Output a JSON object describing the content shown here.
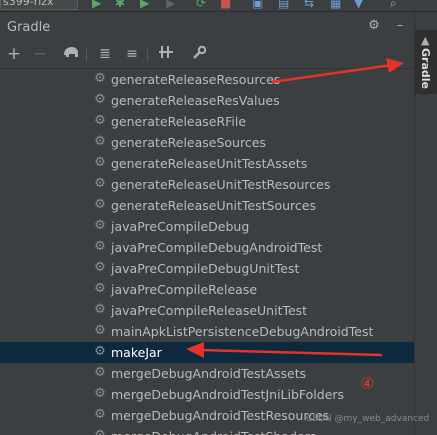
{
  "top_strip": {
    "combo_text": "s399-rizx",
    "icons": [
      "run-icon",
      "debug-icon",
      "attach-icon",
      "rerun-icon",
      "stop-icon",
      "build-icon",
      "layout-icon",
      "sync-icon",
      "device-icon",
      "search-icon"
    ]
  },
  "panel": {
    "title": "Gradle",
    "gear_label": "⚙",
    "hide_label": "–"
  },
  "toolbar": {
    "add_label": "+",
    "remove_label": "−",
    "elephant_label": "▲",
    "expand_label": "≣",
    "collapse_label": "≡",
    "link_label": "∥",
    "wrench_label": "⚒"
  },
  "side_tab": {
    "label": "Gradle",
    "icon": "elephant-icon"
  },
  "tasks": [
    "generateReleaseResources",
    "generateReleaseResValues",
    "generateReleaseRFile",
    "generateReleaseSources",
    "generateReleaseUnitTestAssets",
    "generateReleaseUnitTestResources",
    "generateReleaseUnitTestSources",
    "javaPreCompileDebug",
    "javaPreCompileDebugAndroidTest",
    "javaPreCompileDebugUnitTest",
    "javaPreCompileRelease",
    "javaPreCompileReleaseUnitTest",
    "mainApkListPersistenceDebugAndroidTest",
    "makeJar",
    "mergeDebugAndroidTestAssets",
    "mergeDebugAndroidTestJniLibFolders",
    "mergeDebugAndroidTestResources",
    "mergeDebugAndroidTestShaders"
  ],
  "selected_task": "makeJar",
  "annotation_number": "④",
  "watermark": "CSDN @my_web_advanced",
  "colors": {
    "selection": "#0d293e",
    "arrow": "#e5332a",
    "panel_bg": "#3c3f41"
  }
}
